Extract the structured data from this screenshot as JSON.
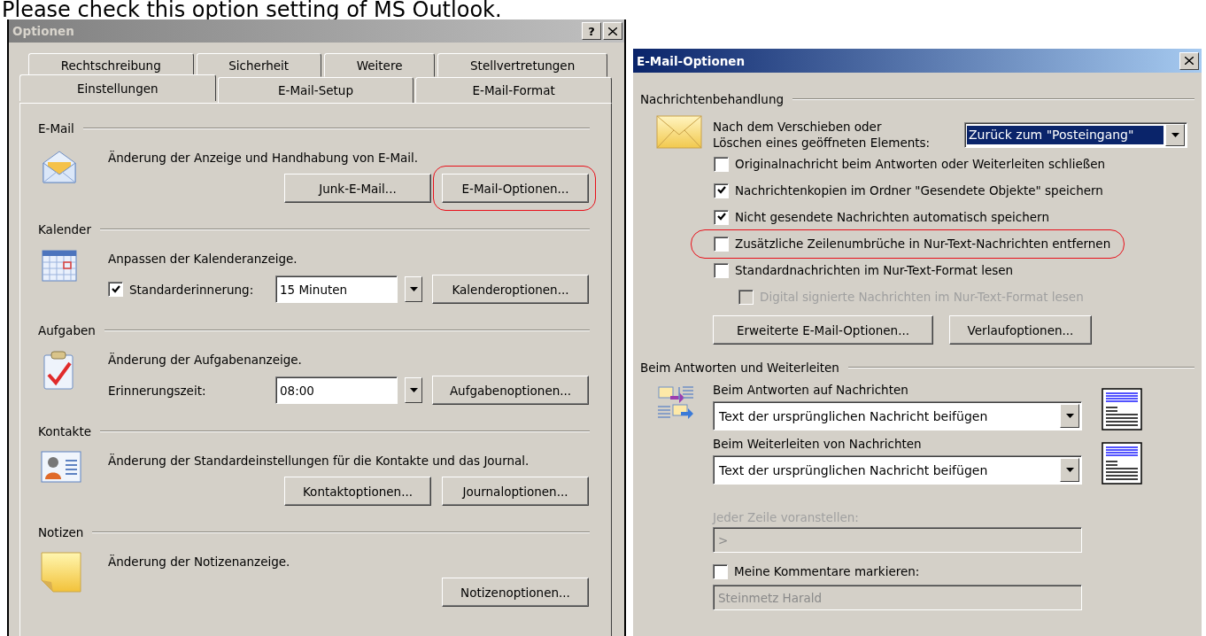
{
  "caption": "Please check this option setting of MS Outlook.",
  "options_dialog": {
    "title": "Optionen",
    "help_button": "?",
    "tab_rows": [
      [
        {
          "label": "Rechtschreibung",
          "selected": false
        },
        {
          "label": "Sicherheit",
          "selected": false
        },
        {
          "label": "Weitere",
          "selected": false
        },
        {
          "label": "Stellvertretungen",
          "selected": false
        }
      ],
      [
        {
          "label": "Einstellungen",
          "selected": true
        },
        {
          "label": "E-Mail-Setup",
          "selected": false
        },
        {
          "label": "E-Mail-Format",
          "selected": false
        }
      ]
    ],
    "sections": [
      {
        "kind": "mail",
        "heading": "E-Mail",
        "description": "Änderung der Anzeige und Handhabung von E-Mail.",
        "row": [
          {
            "kind": "button",
            "label": "Junk-E-Mail...",
            "highlighted": false
          },
          {
            "kind": "button",
            "label": "E-Mail-Optionen...",
            "highlighted": true
          }
        ]
      },
      {
        "kind": "calendar",
        "heading": "Kalender",
        "description": "Anpassen der Kalenderanzeige.",
        "row": [
          {
            "kind": "checkbox",
            "label": "Standarderinnerung:",
            "checked": true
          },
          {
            "kind": "dropdown",
            "value": "15 Minuten"
          },
          {
            "kind": "button",
            "label": "Kalenderoptionen...",
            "highlighted": false
          }
        ]
      },
      {
        "kind": "tasks",
        "heading": "Aufgaben",
        "description": "Änderung der Aufgabenanzeige.",
        "row": [
          {
            "kind": "label",
            "label": "Erinnerungszeit:"
          },
          {
            "kind": "dropdown",
            "value": "08:00"
          },
          {
            "kind": "button",
            "label": "Aufgabenoptionen...",
            "highlighted": false
          }
        ]
      },
      {
        "kind": "contacts",
        "heading": "Kontakte",
        "description": "Änderung der Standardeinstellungen für die Kontakte und das Journal.",
        "row": [
          {
            "kind": "button",
            "label": "Kontaktoptionen...",
            "highlighted": false
          },
          {
            "kind": "button",
            "label": "Journaloptionen...",
            "highlighted": false
          }
        ]
      },
      {
        "kind": "notes",
        "heading": "Notizen",
        "description": "Änderung der Notizenanzeige.",
        "row": [
          {
            "kind": "button",
            "label": "Notizenoptionen...",
            "highlighted": false
          }
        ]
      }
    ]
  },
  "mail_options_dialog": {
    "title": "E-Mail-Optionen",
    "handling": {
      "heading": "Nachrichtenbehandlung",
      "after_move_label": "Nach dem Verschieben oder\nLöschen eines geöffneten Elements:",
      "after_move_value": "Zurück zum \"Posteingang\"",
      "options": [
        {
          "label": "Originalnachricht beim Antworten oder Weiterleiten schließen",
          "checked": false,
          "disabled": false,
          "highlighted": false
        },
        {
          "label": "Nachrichtenkopien im Ordner \"Gesendete Objekte\" speichern",
          "checked": true,
          "disabled": false,
          "highlighted": false
        },
        {
          "label": "Nicht gesendete Nachrichten automatisch speichern",
          "checked": true,
          "disabled": false,
          "highlighted": false
        },
        {
          "label": "Zusätzliche Zeilenumbrüche in Nur-Text-Nachrichten entfernen",
          "checked": false,
          "disabled": false,
          "highlighted": true
        },
        {
          "label": "Standardnachrichten im Nur-Text-Format lesen",
          "checked": false,
          "disabled": false,
          "highlighted": false,
          "children": [
            {
              "label": "Digital signierte Nachrichten im Nur-Text-Format lesen",
              "checked": false,
              "disabled": true,
              "highlighted": false
            }
          ]
        }
      ],
      "buttons": [
        "Erweiterte E-Mail-Optionen...",
        "Verlaufoptionen..."
      ]
    },
    "reply_forward": {
      "heading": "Beim Antworten und Weiterleiten",
      "reply_label": "Beim Antworten auf Nachrichten",
      "reply_value": "Text der ursprünglichen Nachricht beifügen",
      "forward_label": "Beim Weiterleiten von Nachrichten",
      "forward_value": "Text der ursprünglichen Nachricht beifügen",
      "prefix_label": "Jeder Zeile voranstellen:",
      "prefix_value": ">",
      "prefix_disabled": true,
      "mark_comments": {
        "label": "Meine Kommentare markieren:",
        "checked": false
      },
      "comments_name": "Steinmetz Harald",
      "comments_disabled": true
    }
  }
}
